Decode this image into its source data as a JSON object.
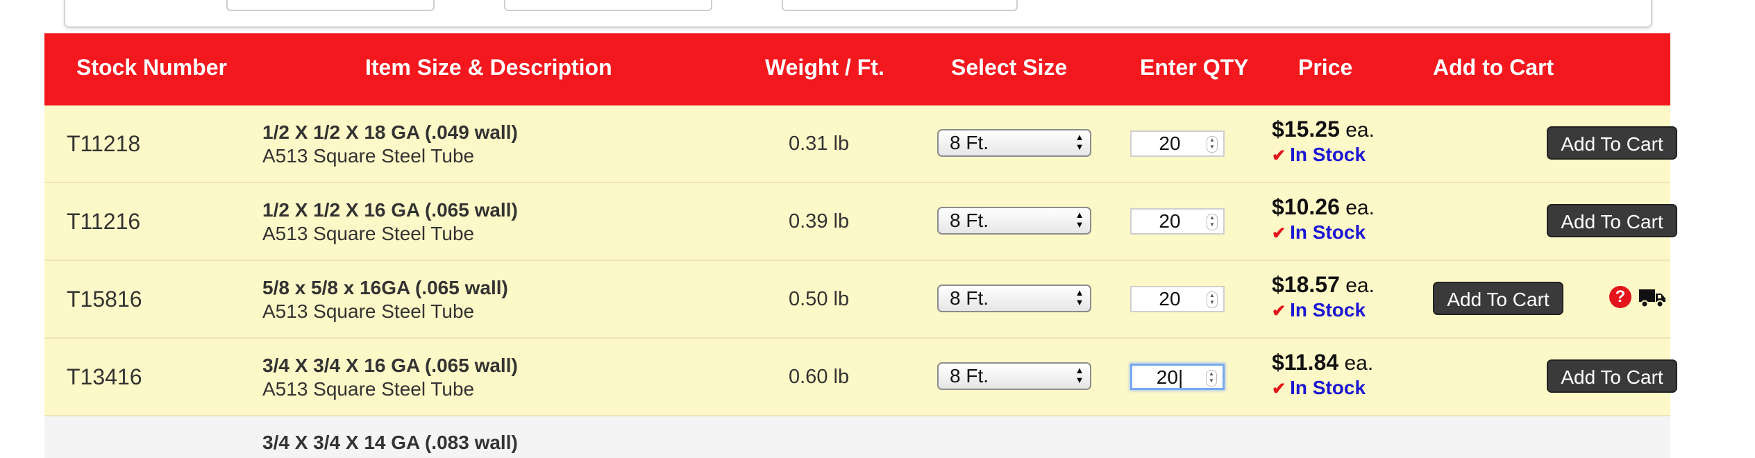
{
  "headers": {
    "stock_number": "Stock Number",
    "item": "Item Size & Description",
    "weight": "Weight / Ft.",
    "select_size": "Select Size",
    "enter_qty": "Enter QTY",
    "price": "Price",
    "add_to_cart": "Add to Cart"
  },
  "rows": [
    {
      "stock": "T11218",
      "size": "1/2 X 1/2 X 18 GA (.049 wall)",
      "name": "A513 Square Steel Tube",
      "weight": "0.31 lb",
      "length": "8 Ft.",
      "qty": "20",
      "price": "$15.25",
      "unit": "ea.",
      "status": "In Stock",
      "button": "Add To Cart"
    },
    {
      "stock": "T11216",
      "size": "1/2 X 1/2 X 16 GA (.065 wall)",
      "name": "A513 Square Steel Tube",
      "weight": "0.39 lb",
      "length": "8 Ft.",
      "qty": "20",
      "price": "$10.26",
      "unit": "ea.",
      "status": "In Stock",
      "button": "Add To Cart"
    },
    {
      "stock": "T15816",
      "size": "5/8 x 5/8 x 16GA (.065 wall)",
      "name": "A513 Square Steel Tube",
      "weight": "0.50 lb",
      "length": "8 Ft.",
      "qty": "20",
      "price": "$18.57",
      "unit": "ea.",
      "status": "In Stock",
      "button": "Add To Cart"
    },
    {
      "stock": "T13416",
      "size": "3/4 X 3/4 X 16 GA (.065 wall)",
      "name": "A513 Square Steel Tube",
      "weight": "0.60 lb",
      "length": "8 Ft.",
      "qty": "20",
      "price": "$11.84",
      "unit": "ea.",
      "status": "In Stock",
      "button": "Add To Cart"
    }
  ],
  "partial_row": {
    "size": "3/4 X 3/4 X 14 GA (.083 wall)"
  },
  "colors": {
    "header_bg": "#f2181e",
    "row_bg": "#fdf8c7",
    "stock_text": "#1b17d3",
    "button_bg": "#3a3a3a"
  },
  "icons": {
    "check": "check-icon",
    "help": "question-circle-icon",
    "truck": "truck-icon"
  }
}
